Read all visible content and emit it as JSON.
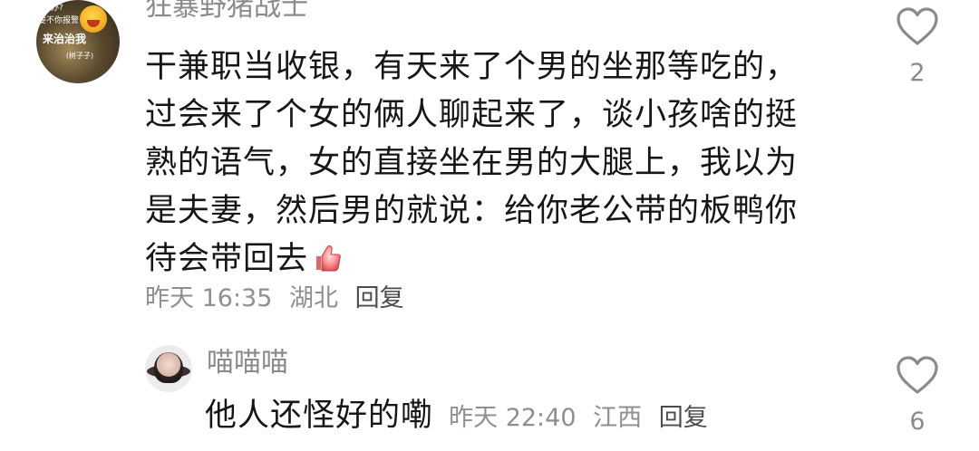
{
  "comment": {
    "username": "狂暴野猪战士",
    "avatar_caption_lines": [
      "怎么办?",
      "要不你报警",
      "来治治我",
      "(树子子)"
    ],
    "text": "干兼职当收银，有天来了个男的坐那等吃的，过会来了个女的俩人聊起来了，谈小孩啥的挺熟的语气，女的直接坐在男的大腿上，我以为是夫妻，然后男的就说：给你老公带的板鸭你待会带回去",
    "emoji": "thumbs-up-emoji",
    "time": "昨天 16:35",
    "location": "湖北",
    "reply_label": "回复",
    "likes": "2",
    "icon": "heart-outline-icon"
  },
  "reply": {
    "username": "喵喵喵",
    "text": "他人还怪好的嘞",
    "time": "昨天 22:40",
    "location": "江西",
    "reply_label": "回复",
    "likes": "6",
    "icon": "heart-outline-icon"
  },
  "colors": {
    "username": "#8a8a8a",
    "body": "#161616",
    "meta": "#8f8f8f",
    "reply_action": "#4c4c4c",
    "heart_stroke": "#8a8a8a"
  }
}
